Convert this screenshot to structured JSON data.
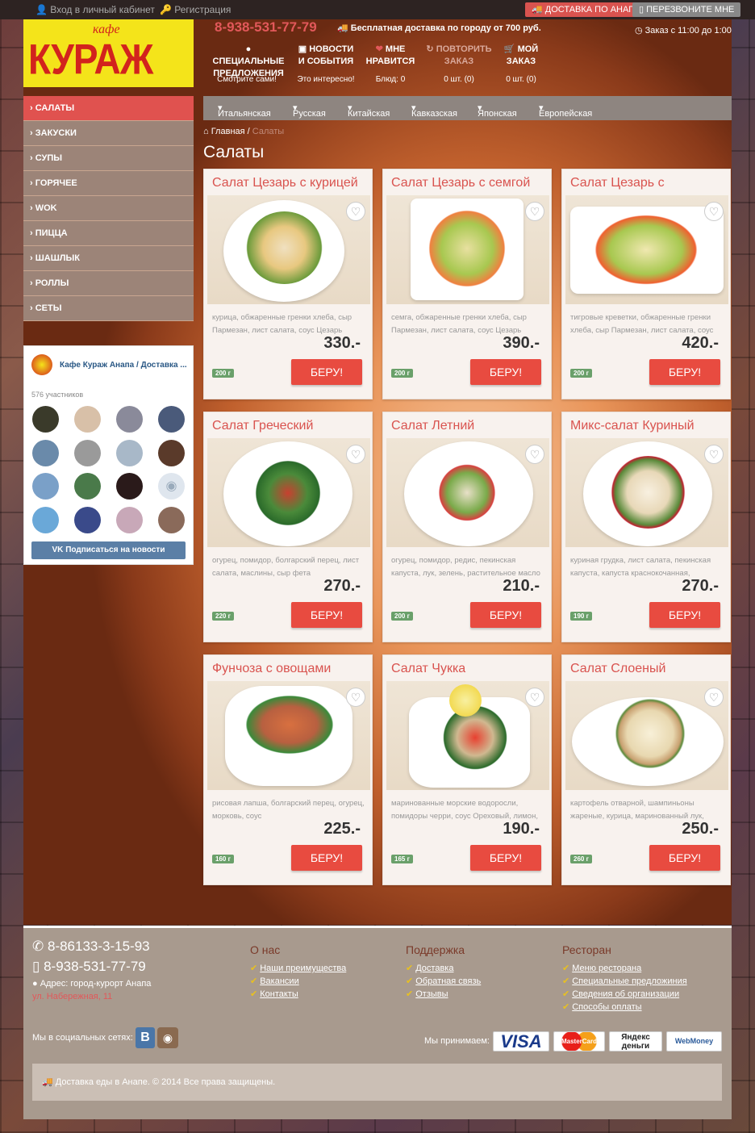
{
  "topbar": {
    "login": "Вход в личный кабинет",
    "register": "Регистрация",
    "delivery_btn": "ДОСТАВКА ПО АНАПЕ",
    "callback_btn": "ПЕРЕЗВОНИТЕ МНЕ"
  },
  "header": {
    "logo_cafe": "кафе",
    "logo_name": "КУРАЖ",
    "phone": "8-938-531-77-79",
    "delivery_note": "Бесплатная доставка по городу от 700 руб.",
    "hours": "Заказ с 11:00 до 1:00",
    "nav": [
      {
        "label": "СПЕЦИАЛЬНЫЕ\nПРЕДЛОЖЕНИЯ",
        "sub": "Смотрите сами!"
      },
      {
        "label": "НОВОСТИ\nИ СОБЫТИЯ",
        "sub": "Это интересно!"
      },
      {
        "label": "МНЕ\nНРАВИТСЯ",
        "sub": "Блюд: 0"
      },
      {
        "label": "ПОВТОРИТЬ\nЗАКАЗ",
        "sub": "0 шт. (0)"
      },
      {
        "label": "МОЙ\nЗАКАЗ",
        "sub": "0 шт. (0)"
      }
    ]
  },
  "sidebar": {
    "items": [
      "САЛАТЫ",
      "ЗАКУСКИ",
      "СУПЫ",
      "ГОРЯЧЕЕ",
      "WOK",
      "ПИЦЦА",
      "ШАШЛЫК",
      "РОЛЛЫ",
      "СЕТЫ"
    ]
  },
  "cuisines": [
    "Итальянская",
    "Русская",
    "Китайская",
    "Кавказская",
    "Японская",
    "Европейская"
  ],
  "breadcrumb": {
    "home": "Главная",
    "current": "Салаты"
  },
  "page_title": "Салаты",
  "vk": {
    "group": "Кафе Кураж Анапа / Доставка ...",
    "members": "576 участников",
    "subscribe": "Подписаться на новости"
  },
  "buy_label": "БЕРУ!",
  "products": [
    {
      "title": "Салат Цезарь с курицей",
      "desc": "курица, обжаренные гренки хлеба, сыр Пармезан, лист салата, соус Цезарь",
      "price": "330.-",
      "weight": "200 г"
    },
    {
      "title": "Салат Цезарь с семгой",
      "desc": "семга, обжаренные гренки хлеба, сыр Пармезан, лист салата, соус Цезарь",
      "price": "390.-",
      "weight": "200 г"
    },
    {
      "title": "Салат Цезарь с",
      "desc": "тигровые креветки, обжаренные гренки хлеба, сыр Пармезан, лист салата, соус",
      "price": "420.-",
      "weight": "200 г"
    },
    {
      "title": "Салат Греческий",
      "desc": "огурец, помидор, болгарский перец, лист салата, маслины, сыр фета",
      "price": "270.-",
      "weight": "220 г"
    },
    {
      "title": "Салат Летний",
      "desc": "огурец, помидор, редис, пекинская капуста, лук, зелень, растительное масло",
      "price": "210.-",
      "weight": "200 г"
    },
    {
      "title": "Микс-салат Куриный",
      "desc": "куриная грудка, лист салата, пекинская капуста, капуста краснокочанная,",
      "price": "270.-",
      "weight": "190 г"
    },
    {
      "title": "Фунчоза с овощами",
      "desc": "рисовая лапша, болгарский перец, огурец, морковь, соус",
      "price": "225.-",
      "weight": "160 г"
    },
    {
      "title": "Салат Чукка",
      "desc": "маринованные морские водоросли, помидоры черри, соус Ореховый, лимон,",
      "price": "190.-",
      "weight": "165 г"
    },
    {
      "title": "Салат Слоеный",
      "desc": "картофель отварной, шампиньоны жареные, курица, маринованный лук,",
      "price": "250.-",
      "weight": "260 г"
    }
  ],
  "footer": {
    "phone1": "8-86133-3-15-93",
    "phone2": "8-938-531-77-79",
    "address": "Адрес: город-курорт Анапа",
    "street": "ул. Набережная, 11",
    "col1": {
      "title": "О нас",
      "links": [
        "Наши преимущества",
        "Вакансии",
        "Контакты"
      ]
    },
    "col2": {
      "title": "Поддержка",
      "links": [
        "Доставка",
        "Обратная связь",
        "Отзывы"
      ]
    },
    "col3": {
      "title": "Ресторан",
      "links": [
        "Меню ресторана",
        "Специальные предложиния",
        "Сведения об организации",
        "Способы оплаты"
      ]
    },
    "social": "Мы в социальных сетях:",
    "pay_label": "Мы принимаем:",
    "copyright": "Доставка еды в Анапе. © 2014 Все права защищены.",
    "pay": [
      "VISA",
      "MasterCard",
      "Яндекс деньги",
      "WebMoney"
    ]
  }
}
